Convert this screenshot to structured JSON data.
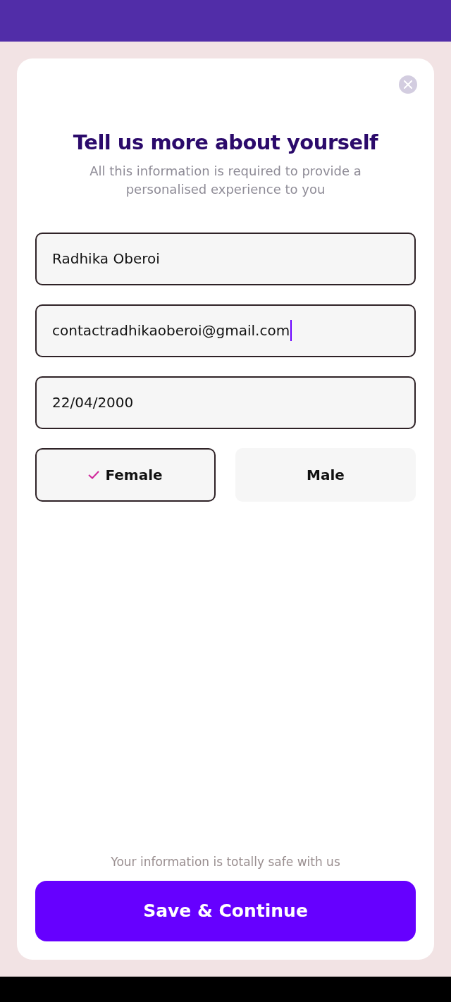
{
  "title": "Tell us more about yourself",
  "subtitle": "All this information is required to provide a personalised experience to you",
  "fields": [
    {
      "value": "Radhika Oberoi",
      "focused": false
    },
    {
      "value": "contactradhikaoberoi@gmail.com",
      "focused": true
    },
    {
      "value": "22/04/2000",
      "focused": false
    }
  ],
  "gender_options": [
    {
      "label": "Female",
      "selected": true
    },
    {
      "label": "Male",
      "selected": false
    }
  ],
  "safety_note": "Your information is totally safe with us",
  "submit_button": "Save & Continue"
}
